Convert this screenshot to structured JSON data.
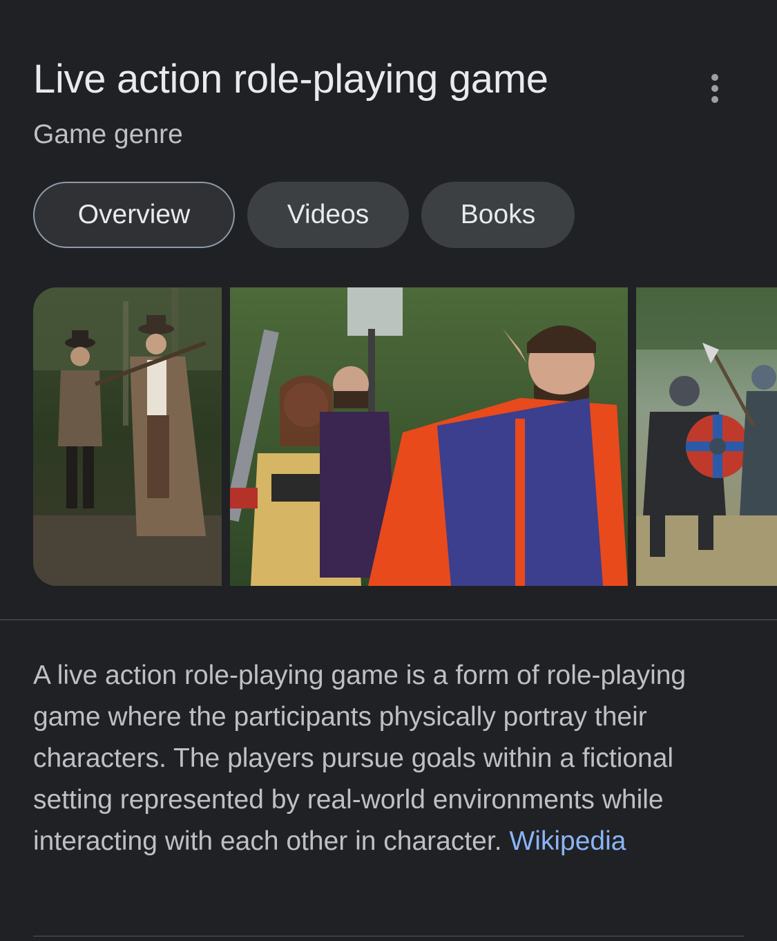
{
  "header": {
    "title": "Live action role-playing game",
    "subtitle": "Game genre",
    "more_icon": "more-vert-icon"
  },
  "tabs": [
    {
      "label": "Overview",
      "active": true
    },
    {
      "label": "Videos",
      "active": false
    },
    {
      "label": "Books",
      "active": false
    }
  ],
  "images": [
    {
      "depicts": "Two costumed men in forest holding muskets"
    },
    {
      "depicts": "LARP participants in costume with elf ears, foam sword"
    },
    {
      "depicts": "Viking reenactment battle with round shields"
    }
  ],
  "description": {
    "text": "A live action role-playing game is a form of role-playing game where the participants physically portray their characters. The players pursue goals within a fictional setting represented by real-world environments while interacting with each other in character.",
    "source_label": "Wikipedia"
  },
  "colors": {
    "background": "#202124",
    "title": "#e8eaed",
    "subtitle": "#bdc1c6",
    "link": "#8ab4f8",
    "chip": "#3c4043"
  }
}
